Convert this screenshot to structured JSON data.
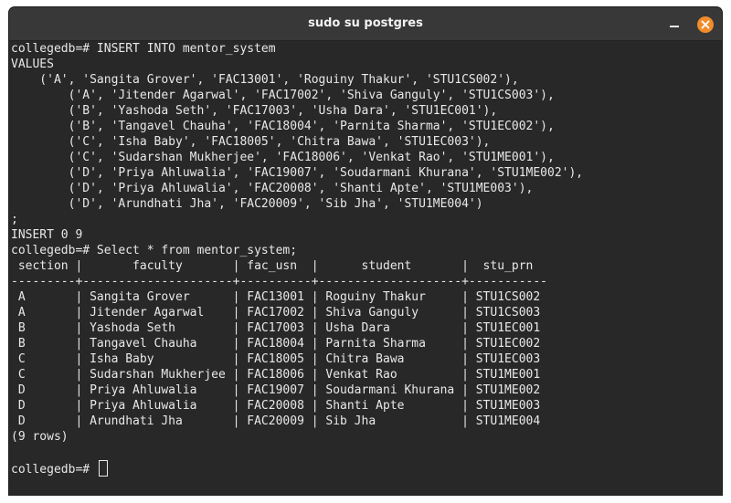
{
  "window": {
    "title": "sudo su postgres"
  },
  "terminal": {
    "lines": [
      "collegedb=# INSERT INTO mentor_system",
      "VALUES",
      "    ('A', 'Sangita Grover', 'FAC13001', 'Roguiny Thakur', 'STU1CS002'),",
      "        ('A', 'Jitender Agarwal', 'FAC17002', 'Shiva Ganguly', 'STU1CS003'),",
      "        ('B', 'Yashoda Seth', 'FAC17003', 'Usha Dara', 'STU1EC001'),",
      "        ('B', 'Tangavel Chauha', 'FAC18004', 'Parnita Sharma', 'STU1EC002'),",
      "        ('C', 'Isha Baby', 'FAC18005', 'Chitra Bawa', 'STU1EC003'),",
      "        ('C', 'Sudarshan Mukherjee', 'FAC18006', 'Venkat Rao', 'STU1ME001'),",
      "        ('D', 'Priya Ahluwalia', 'FAC19007', 'Soudarmani Khurana', 'STU1ME002'),",
      "        ('D', 'Priya Ahluwalia', 'FAC20008', 'Shanti Apte', 'STU1ME003'),",
      "        ('D', 'Arundhati Jha', 'FAC20009', 'Sib Jha', 'STU1ME004')",
      ";",
      "INSERT 0 9",
      "collegedb=# Select * from mentor_system;",
      " section |       faculty       | fac_usn  |      student       |  stu_prn",
      "---------+---------------------+----------+--------------------+-----------",
      " A       | Sangita Grover      | FAC13001 | Roguiny Thakur     | STU1CS002",
      " A       | Jitender Agarwal    | FAC17002 | Shiva Ganguly      | STU1CS003",
      " B       | Yashoda Seth        | FAC17003 | Usha Dara          | STU1EC001",
      " B       | Tangavel Chauha     | FAC18004 | Parnita Sharma     | STU1EC002",
      " C       | Isha Baby           | FAC18005 | Chitra Bawa        | STU1EC003",
      " C       | Sudarshan Mukherjee | FAC18006 | Venkat Rao         | STU1ME001",
      " D       | Priya Ahluwalia     | FAC19007 | Soudarmani Khurana | STU1ME002",
      " D       | Priya Ahluwalia     | FAC20008 | Shanti Apte        | STU1ME003",
      " D       | Arundhati Jha       | FAC20009 | Sib Jha            | STU1ME004",
      "(9 rows)",
      ""
    ],
    "prompt": "collegedb=# "
  },
  "colors": {
    "terminal_bg": "#282828",
    "titlebar_bg": "#383838",
    "text": "#e8e8e8",
    "close_button": "#f08c2c"
  },
  "icons": {
    "minimize": "minimize-icon",
    "close": "close-icon"
  }
}
